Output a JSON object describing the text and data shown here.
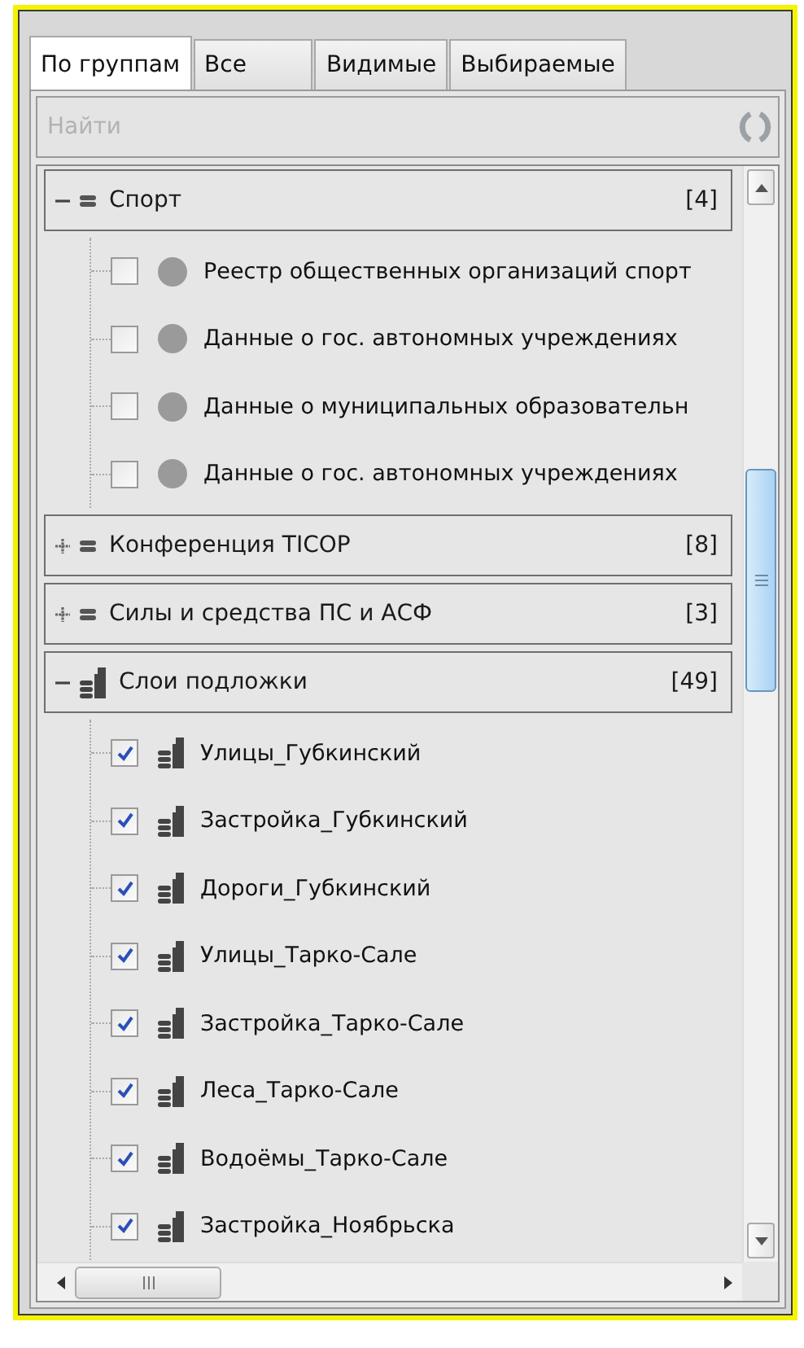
{
  "tabs": [
    {
      "label": "По группам",
      "selected": true
    },
    {
      "label": "Все",
      "selected": false
    },
    {
      "label": "Видимые",
      "selected": false
    },
    {
      "label": "Выбираемые",
      "selected": false
    }
  ],
  "search": {
    "placeholder": "Найти"
  },
  "groups": [
    {
      "name": "Спорт",
      "count": "[4]",
      "expanded": true,
      "kind": "db",
      "children": [
        {
          "label": "Реестр общественных организаций спорт",
          "checked": false,
          "kind": "dot"
        },
        {
          "label": "Данные о гос. автономных учреждениях",
          "checked": false,
          "kind": "dot"
        },
        {
          "label": "Данные о муниципальных образовательн",
          "checked": false,
          "kind": "dot"
        },
        {
          "label": "Данные о гос. автономных учреждениях",
          "checked": false,
          "kind": "dot"
        }
      ]
    },
    {
      "name": "Конференция TICOP",
      "count": "[8]",
      "expanded": false,
      "kind": "db"
    },
    {
      "name": "Силы и средства ПС и АСФ",
      "count": "[3]",
      "expanded": false,
      "kind": "db"
    },
    {
      "name": "Слои подложки",
      "count": "[49]",
      "expanded": true,
      "kind": "layers",
      "children": [
        {
          "label": "Улицы_Губкинский",
          "checked": true,
          "kind": "layers"
        },
        {
          "label": "Застройка_Губкинский",
          "checked": true,
          "kind": "layers"
        },
        {
          "label": "Дороги_Губкинский",
          "checked": true,
          "kind": "layers"
        },
        {
          "label": "Улицы_Тарко-Сале",
          "checked": true,
          "kind": "layers"
        },
        {
          "label": "Застройка_Тарко-Сале",
          "checked": true,
          "kind": "layers"
        },
        {
          "label": "Леса_Тарко-Сале",
          "checked": true,
          "kind": "layers"
        },
        {
          "label": "Водоёмы_Тарко-Сале",
          "checked": true,
          "kind": "layers"
        },
        {
          "label": "Застройка_Ноябрьска",
          "checked": true,
          "kind": "layers"
        }
      ]
    }
  ]
}
